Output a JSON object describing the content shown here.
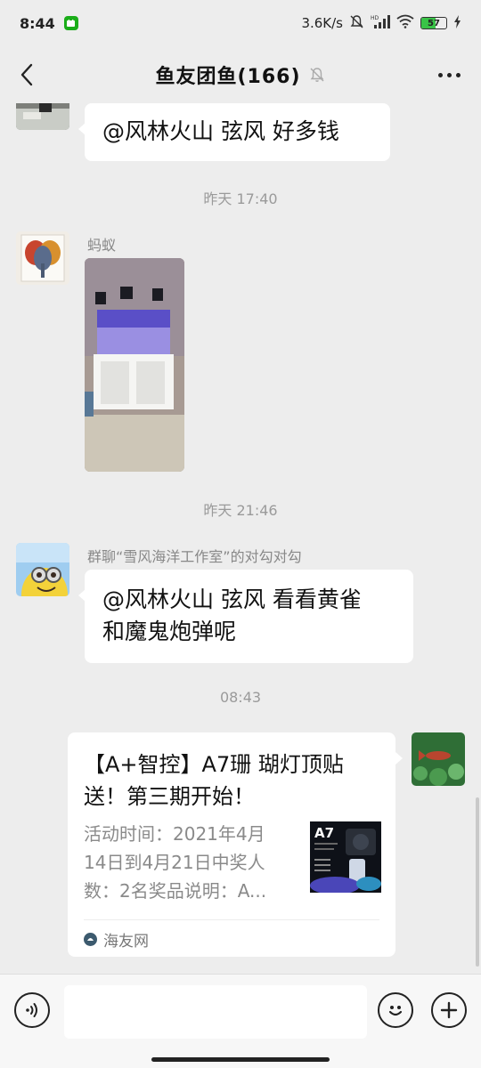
{
  "status_bar": {
    "time": "8:44",
    "network_speed": "3.6K/s",
    "battery_level": "57",
    "battery_fraction": 0.57,
    "icons": [
      "wechat-notification-icon",
      "mute-bell-icon",
      "hd-signal-icon",
      "wifi-icon",
      "battery-icon",
      "charging-icon"
    ]
  },
  "title_bar": {
    "title": "鱼友团鱼(166)",
    "back_icon": "chevron-left-icon",
    "mute_icon": "bell-off-icon",
    "more_icon": "more-dots-icon"
  },
  "messages": [
    {
      "type": "text",
      "side": "left",
      "text": "@风林火山 弦风  好多钱"
    },
    {
      "type": "timestamp",
      "text": "昨天 17:40"
    },
    {
      "type": "image",
      "side": "left",
      "sender": "蚂蚁"
    },
    {
      "type": "timestamp",
      "text": "昨天 21:46"
    },
    {
      "type": "text",
      "side": "left",
      "sender": "群聊“雪风海洋工作室”的对勾对勾",
      "line1": "@风林火山 弦风  看看黄雀",
      "line2": "和魔鬼炮弹呢"
    },
    {
      "type": "timestamp",
      "text": "08:43"
    },
    {
      "type": "link",
      "side": "right",
      "title_line1": "【A+智控】A7珊 瑚灯顶贴",
      "title_line2": "送！第三期开始！",
      "desc_line1": "活动时间：2021年4月",
      "desc_line2": "14日到4月21日中奖人",
      "desc_line3": "数：2名奖品说明：A...",
      "thumb_label": "A7",
      "source": "海友网"
    }
  ],
  "input_bar": {
    "voice_icon": "voice-input-icon",
    "emoji_icon": "emoji-icon",
    "plus_icon": "plus-icon",
    "value": ""
  }
}
